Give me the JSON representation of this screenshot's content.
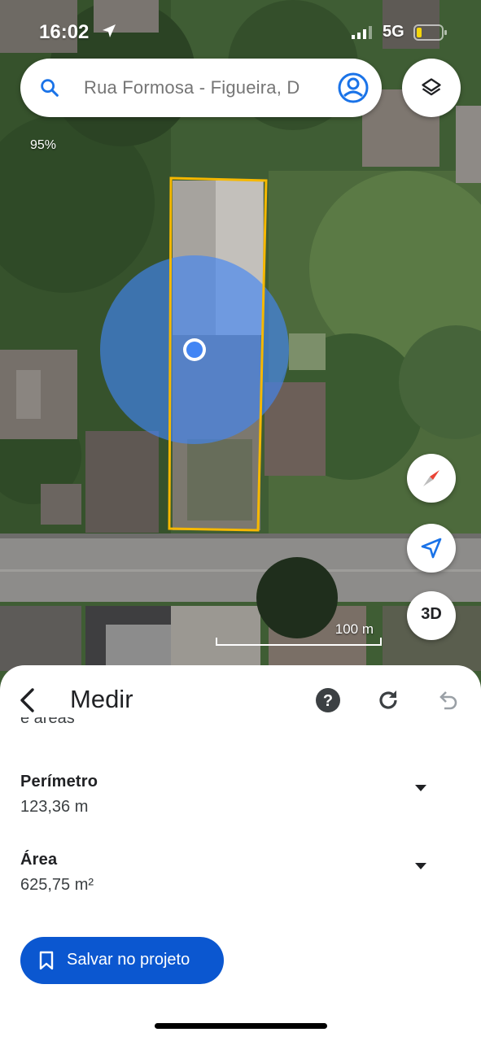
{
  "status_bar": {
    "time": "16:02",
    "network": "5G"
  },
  "search": {
    "text": "Rua Formosa - Figueira, D"
  },
  "map": {
    "zoom_percent": "95%",
    "scale_label": "100 m",
    "three_d_label": "3D",
    "measurement_outline_color": "#f6b800",
    "location_dot_color": "#4285f4"
  },
  "sheet": {
    "title": "Medir",
    "cut_text": "e áreas",
    "perimeter": {
      "label": "Perímetro",
      "value": "123,36 m"
    },
    "area": {
      "label": "Área",
      "value": "625,75 m²"
    },
    "save_button_label": "Salvar no projeto",
    "accent_color": "#0b57d0"
  }
}
